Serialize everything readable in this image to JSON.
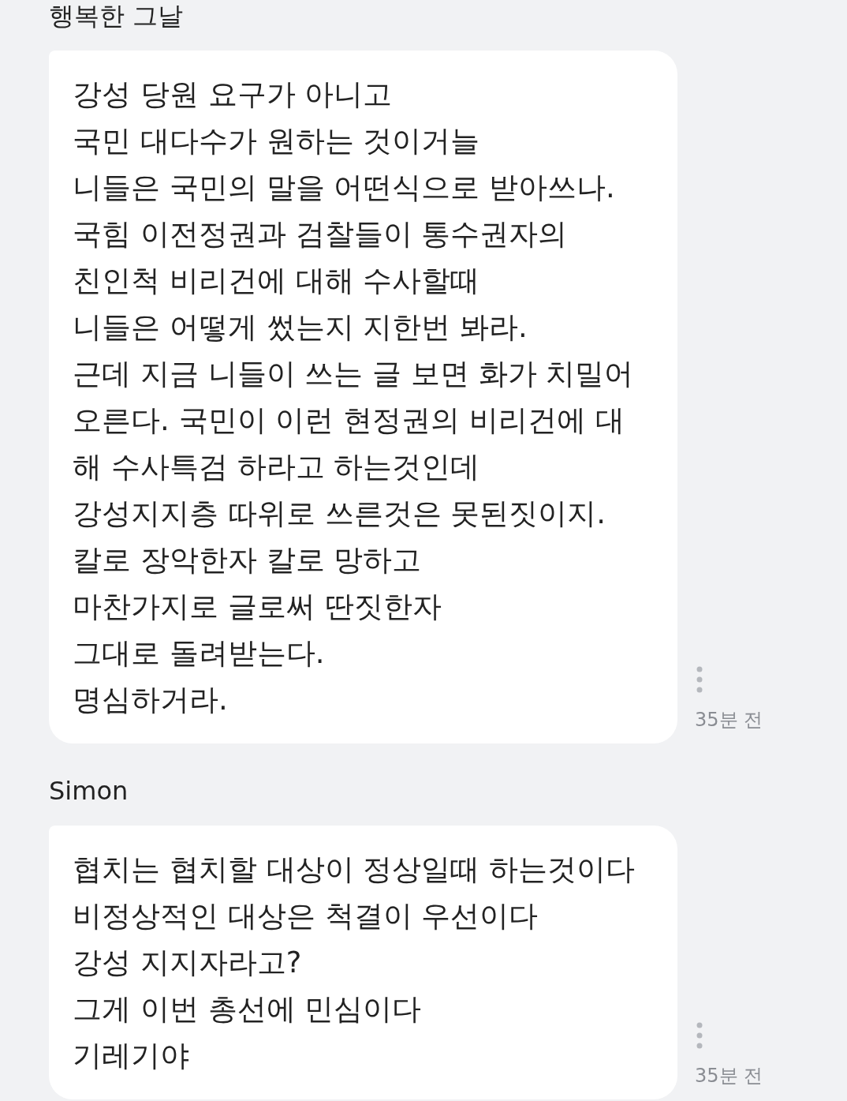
{
  "comments": [
    {
      "author": "행복한 그날",
      "text": "강성 당원 요구가 아니고\n국민 대다수가 원하는 것이거늘\n니들은 국민의 말을 어떤식으로 받아쓰나.\n국힘 이전정권과 검찰들이 통수권자의\n친인척 비리건에 대해 수사할때\n니들은 어떻게 썼는지 지한번 봐라.\n근데 지금 니들이 쓰는 글 보면 화가 치밀어\n오른다. 국민이 이런 현정권의 비리건에 대\n해 수사특검 하라고 하는것인데\n강성지지층 따위로 쓰른것은 못된짓이지.\n칼로 장악한자 칼로 망하고\n마찬가지로 글로써 딴짓한자\n그대로 돌려받는다.\n명심하거라.",
      "time": "35분 전"
    },
    {
      "author": "Simon",
      "text": "협치는 협치할 대상이 정상일때 하는것이다\n비정상적인 대상은 척결이 우선이다\n강성 지지자라고?\n그게 이번 총선에 민심이다\n기레기야",
      "time": "35분 전"
    }
  ]
}
